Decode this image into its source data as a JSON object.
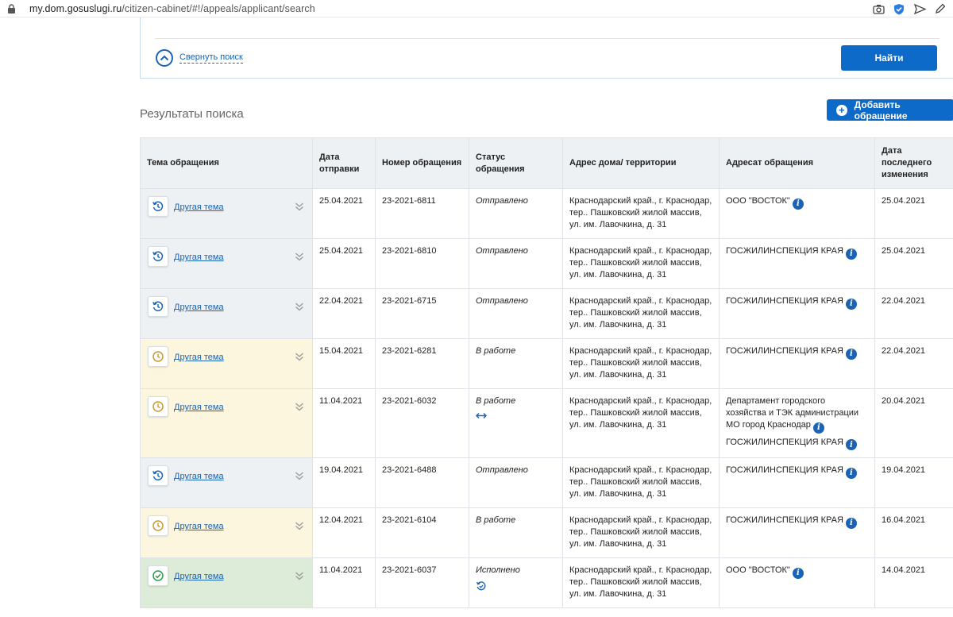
{
  "browser": {
    "url_host": "my.dom.gosuslugi.ru",
    "url_path": "/citizen-cabinet/#!/appeals/applicant/search"
  },
  "search": {
    "collapse_label": "Свернуть поиск",
    "find_label": "Найти"
  },
  "results": {
    "title": "Результаты поиска",
    "add_label": "Добавить обращение"
  },
  "table": {
    "headers": {
      "theme": "Тема обращения",
      "date_sent": "Дата отправки",
      "number": "Номер обращения",
      "status": "Статус обращения",
      "address": "Адрес дома/ территории",
      "addressee": "Адресат обращения",
      "last_change": "Дата последнего изменения"
    },
    "rows": [
      {
        "theme": "Другая тема",
        "date": "25.04.2021",
        "number": "23-2021-6811",
        "status": "Отправлено",
        "address": "Краснодарский край., г. Краснодар, тер.. Пашковский жилой массив, ул. им. Лавочкина, д. 31",
        "addressee": "ООО \"ВОСТОК\"",
        "addressee2": "",
        "changed": "25.04.2021"
      },
      {
        "theme": "Другая тема",
        "date": "25.04.2021",
        "number": "23-2021-6810",
        "status": "Отправлено",
        "address": "Краснодарский край., г. Краснодар, тер.. Пашковский жилой массив, ул. им. Лавочкина, д. 31",
        "addressee": "ГОСЖИЛИНСПЕКЦИЯ КРАЯ",
        "addressee2": "",
        "changed": "25.04.2021"
      },
      {
        "theme": "Другая тема",
        "date": "22.04.2021",
        "number": "23-2021-6715",
        "status": "Отправлено",
        "address": "Краснодарский край., г. Краснодар, тер.. Пашковский жилой массив, ул. им. Лавочкина, д. 31",
        "addressee": "ГОСЖИЛИНСПЕКЦИЯ КРАЯ",
        "addressee2": "",
        "changed": "22.04.2021"
      },
      {
        "theme": "Другая тема",
        "date": "15.04.2021",
        "number": "23-2021-6281",
        "status": "В работе",
        "address": "Краснодарский край., г. Краснодар, тер.. Пашковский жилой массив, ул. им. Лавочкина, д. 31",
        "addressee": "ГОСЖИЛИНСПЕКЦИЯ КРАЯ",
        "addressee2": "",
        "changed": "22.04.2021"
      },
      {
        "theme": "Другая тема",
        "date": "11.04.2021",
        "number": "23-2021-6032",
        "status": "В работе",
        "address": "Краснодарский край., г. Краснодар, тер.. Пашковский жилой массив, ул. им. Лавочкина, д. 31",
        "addressee": "Департамент городского хозяйства и ТЭК администрации МО город Краснодар",
        "addressee2": "ГОСЖИЛИНСПЕКЦИЯ КРАЯ",
        "changed": "20.04.2021"
      },
      {
        "theme": "Другая тема",
        "date": "19.04.2021",
        "number": "23-2021-6488",
        "status": "Отправлено",
        "address": "Краснодарский край., г. Краснодар, тер.. Пашковский жилой массив, ул. им. Лавочкина, д. 31",
        "addressee": "ГОСЖИЛИНСПЕКЦИЯ КРАЯ",
        "addressee2": "",
        "changed": "19.04.2021"
      },
      {
        "theme": "Другая тема",
        "date": "12.04.2021",
        "number": "23-2021-6104",
        "status": "В работе",
        "address": "Краснодарский край., г. Краснодар, тер.. Пашковский жилой массив, ул. им. Лавочкина, д. 31",
        "addressee": "ГОСЖИЛИНСПЕКЦИЯ КРАЯ",
        "addressee2": "",
        "changed": "16.04.2021"
      },
      {
        "theme": "Другая тема",
        "date": "11.04.2021",
        "number": "23-2021-6037",
        "status": "Исполнено",
        "address": "Краснодарский край., г. Краснодар, тер.. Пашковский жилой массив, ул. им. Лавочкина, д. 31",
        "addressee": "ООО \"ВОСТОК\"",
        "addressee2": "",
        "changed": "14.04.2021"
      }
    ]
  },
  "colors": {
    "accent": "#0d6ac8",
    "link": "#1a63b5",
    "row_sent": "#eef1f4",
    "row_work": "#fdf6de",
    "row_done": "#dcecd8",
    "icon_clock": "#c99a2e",
    "icon_check": "#2e9a4a"
  },
  "icons": [
    "lock-icon",
    "camera-icon",
    "shield-icon",
    "send-icon",
    "pen-icon",
    "chevron-up-icon",
    "plus-icon",
    "history-icon",
    "clock-icon",
    "check-icon",
    "chevrons-down-icon",
    "info-icon",
    "transfer-arrows-icon"
  ]
}
